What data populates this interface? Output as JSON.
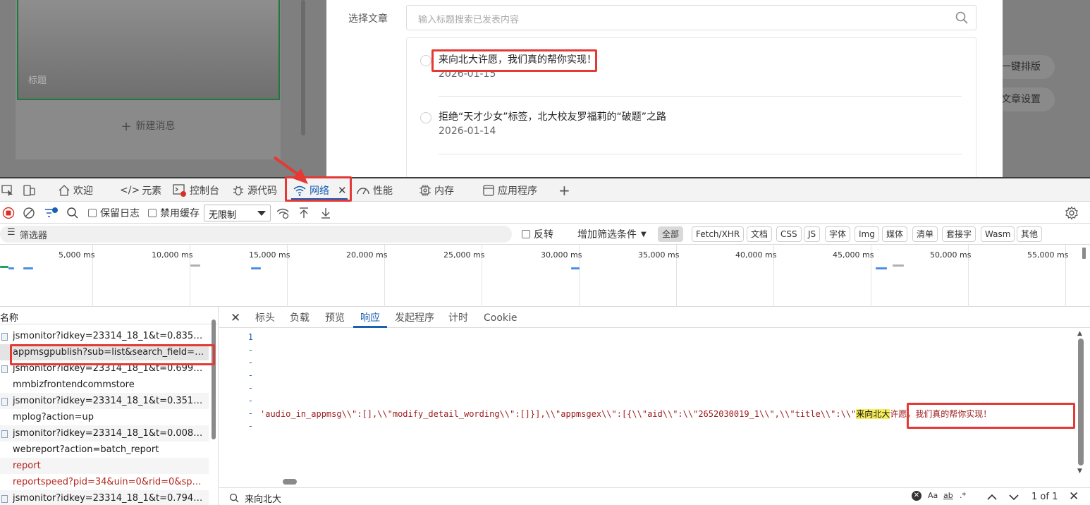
{
  "web_page": {
    "thumb_caption": "标题",
    "new_message": "新建消息",
    "select_label": "选择文章",
    "search_placeholder": "输入标题搜索已发表内容",
    "articles": [
      {
        "title": "来向北大许愿，我们真的帮你实现！",
        "date": "2026-01-15"
      },
      {
        "title": "拒绝“天才少女”标签，北大校友罗福莉的“破题”之路",
        "date": "2026-01-14"
      }
    ],
    "side_buttons": [
      "一键排版",
      "文章设置"
    ]
  },
  "devtools": {
    "tabs": [
      "欢迎",
      "元素",
      "控制台",
      "源代码",
      "网络",
      "性能",
      "内存",
      "应用程序"
    ],
    "toolbar": {
      "preserve_log": "保留日志",
      "disable_cache": "禁用缓存",
      "throttle": "无限制"
    },
    "filter": {
      "placeholder": "筛选器",
      "invert": "反转",
      "more_filters": "增加筛选条件",
      "types": [
        "全部",
        "Fetch/XHR",
        "文档",
        "CSS",
        "JS",
        "字体",
        "Img",
        "媒体",
        "清单",
        "套接字",
        "Wasm",
        "其他"
      ]
    },
    "timeline_labels": [
      "5,000 ms",
      "10,000 ms",
      "15,000 ms",
      "20,000 ms",
      "25,000 ms",
      "30,000 ms",
      "35,000 ms",
      "40,000 ms",
      "45,000 ms",
      "50,000 ms",
      "55,000 ms"
    ],
    "request_list": {
      "header": "名称",
      "rows": [
        "jsmonitor?idkey=23314_18_1&t=0.83541...",
        "appmsgpublish?sub=list&search_field=n...",
        "jsmonitor?idkey=23314_18_1&t=0.69959...",
        "mmbizfrontendcommstore",
        "jsmonitor?idkey=23314_18_1&t=0.35132...",
        "mplog?action=up",
        "jsmonitor?idkey=23314_18_1&t=0.00847...",
        "webreport?action=batch_report",
        "report",
        "reportspeed?pid=34&uin=0&rid=0&spe...",
        "jsmonitor?idkey=23314_18_1&t=0.79444..."
      ]
    },
    "response": {
      "tabs": [
        "标头",
        "负载",
        "预览",
        "响应",
        "发起程序",
        "计时",
        "Cookie"
      ],
      "line_numbers": [
        "1",
        "-",
        "-",
        "-",
        "-",
        "-",
        "-",
        "-"
      ],
      "code_before": "'audio_in_appmsg\\\\\":[],\\\\\"modify_detail_wording\\\\\":[]}],\\\\\"appmsgex\\\\\":[{\\\\\"aid\\\\\":\\\\\"2652030019_1\\\\\",\\\\\"title\\\\\":\\\\\"",
      "code_highlight": "来向北大",
      "code_after": "许愿，我们真的帮你实现！",
      "search_query": "来向北大",
      "search_opts": [
        "Aa",
        "ab",
        ".*"
      ],
      "match_count": "1 of 1"
    }
  }
}
